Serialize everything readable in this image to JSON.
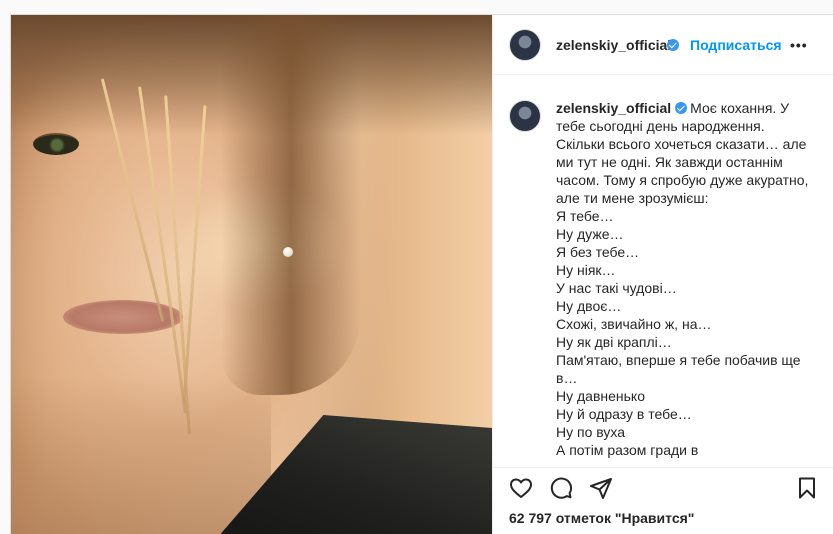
{
  "post": {
    "username": "zelenskiy_official",
    "follow_label": "Подписаться",
    "more_label": "•••",
    "caption_lines": [
      "Моє кохання. У",
      "тебе сьогодні день народження.",
      "Скільки всього хочеться сказати… але",
      "ми тут не одні. Як завжди останнім",
      "часом. Тому я спробую дуже акуратно,",
      "але ти мене зрозумієш:",
      "Я тебе…",
      "Ну дуже…",
      "Я без тебе…",
      "Ну ніяк…",
      "У нас такі чудові…",
      "Ну двоє…",
      "Схожі, звичайно ж, на…",
      "Ну як дві краплі…",
      "Пам'ятаю, вперше я тебе побачив ще",
      "в…",
      "Ну давненько",
      "Ну й одразу в тебе…",
      "Ну по вуха",
      "А потім разом гради в"
    ],
    "likes_label": "62 797 отметок \"Нравится\""
  },
  "icons": {
    "like": "heart-icon",
    "comment": "comment-icon",
    "share": "share-icon",
    "save": "bookmark-icon",
    "verified": "verified-badge-icon"
  },
  "colors": {
    "accent": "#0095f6",
    "verified": "#3897f0",
    "text": "#262626",
    "border": "#dbdbdb"
  }
}
